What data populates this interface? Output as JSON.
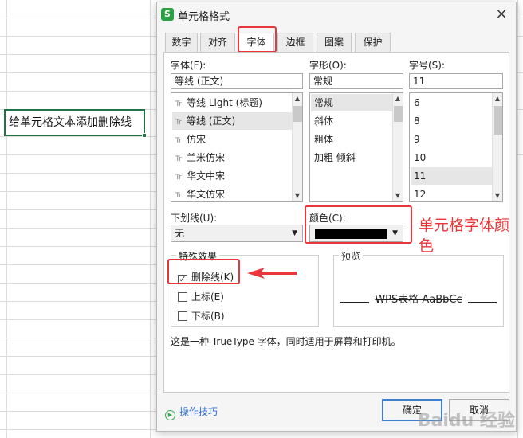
{
  "cell": {
    "text": "给单元格文本添加删除线"
  },
  "dialog": {
    "title": "单元格格式",
    "close": "×",
    "tabs": [
      {
        "label": "数字"
      },
      {
        "label": "对齐"
      },
      {
        "label": "字体",
        "active": true
      },
      {
        "label": "边框"
      },
      {
        "label": "图案"
      },
      {
        "label": "保护"
      }
    ],
    "font": {
      "label": "字体(F):",
      "value": "等线 (正文)",
      "items": [
        "等线 Light (标题)",
        "等线 (正文)",
        "仿宋",
        "兰米仿宋",
        "华文中宋",
        "华文仿宋"
      ],
      "selected_index": 1
    },
    "style": {
      "label": "字形(O):",
      "value": "常规",
      "items": [
        "常规",
        "斜体",
        "粗体",
        "加粗 倾斜"
      ],
      "selected_index": 0
    },
    "size": {
      "label": "字号(S):",
      "value": "11",
      "items": [
        "6",
        "8",
        "9",
        "10",
        "11",
        "12"
      ],
      "selected_index": 4
    },
    "underline": {
      "label": "下划线(U):",
      "value": "无"
    },
    "color": {
      "label": "颜色(C):",
      "value_color": "#000000"
    },
    "effects": {
      "title": "特殊效果",
      "strikethrough": {
        "label": "删除线(K)",
        "checked": true,
        "mark": "✓"
      },
      "superscript": {
        "label": "上标(E)",
        "checked": false
      },
      "subscript": {
        "label": "下标(B)",
        "checked": false
      }
    },
    "preview": {
      "title": "预览",
      "text": "WPS表格  AaBbCc"
    },
    "note": "这是一种 TrueType 字体，同时适用于屏幕和打印机。",
    "tips": "操作技巧",
    "ok": "确定",
    "cancel": "取消"
  },
  "annotation": {
    "text": "单元格字体颜色",
    "color": "#e8363a"
  },
  "watermark": "Baidu 经验"
}
